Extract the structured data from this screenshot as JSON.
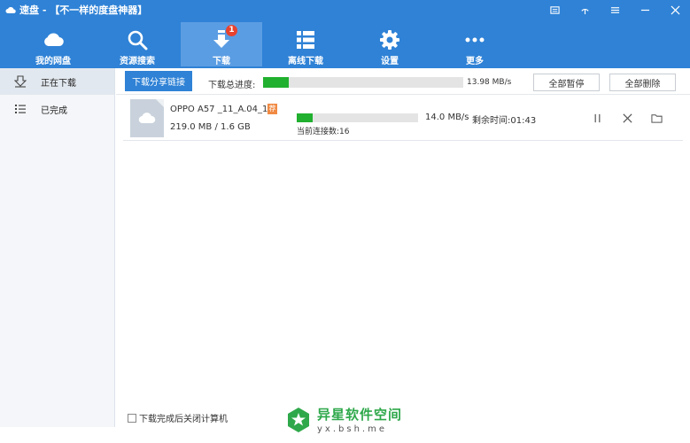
{
  "app": {
    "title": "速盘 - 【不一样的度盘神器】"
  },
  "nav": {
    "items": [
      {
        "label": "我的网盘",
        "icon": "cloud-icon"
      },
      {
        "label": "资源搜索",
        "icon": "search-icon"
      },
      {
        "label": "下载",
        "icon": "download-icon",
        "badge": "1"
      },
      {
        "label": "离线下载",
        "icon": "list-icon"
      },
      {
        "label": "设置",
        "icon": "gear-icon"
      },
      {
        "label": "更多",
        "icon": "more-icon"
      }
    ]
  },
  "sidebar": {
    "items": [
      {
        "label": "正在下载",
        "icon": "download-arrow-icon"
      },
      {
        "label": "已完成",
        "icon": "list-icon"
      }
    ]
  },
  "toolbar": {
    "share_label": "下载分享链接",
    "total_label": "下载总进度:",
    "total_speed": "13.98 MB/s",
    "total_progress": 0.13,
    "pause_all_label": "全部暂停",
    "delete_all_label": "全部删除"
  },
  "task": {
    "name": "OPPO A57 _11_A.04_1...",
    "tag": "荐",
    "size": "219.0 MB / 1.6 GB",
    "progress": 0.13,
    "speed": "14.0 MB/s",
    "remaining": "剩余时间:01:43",
    "connections": "当前连接数:16"
  },
  "footer": {
    "shutdown_label": "下载完成后关闭计算机"
  },
  "watermark": {
    "title": "异星软件空间",
    "url": "yx.bsh.me"
  },
  "colors": {
    "header": "#2f82d6",
    "progress": "#21b02f",
    "badge": "#e8432f"
  }
}
